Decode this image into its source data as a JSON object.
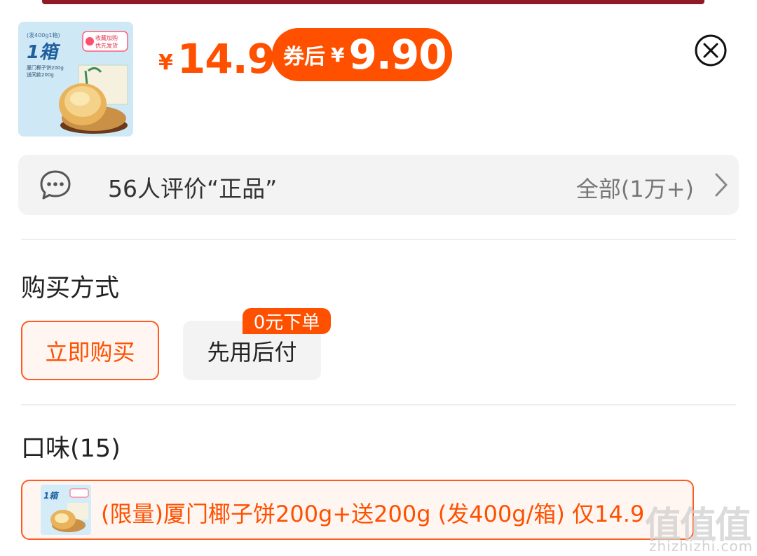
{
  "price": {
    "currency": "¥",
    "original": "14.9",
    "coupon_label": "券后",
    "coupon_currency": "¥",
    "coupon_price": "9.90"
  },
  "thumb": {
    "spec": "(发400g1箱)",
    "box_label": "1箱",
    "promo_line1": "收藏加购",
    "promo_line2": "优先发货",
    "desc_line1": "厦门椰子饼200g",
    "desc_line2": "送同款200g"
  },
  "reviews": {
    "summary": "56人评价“正品”",
    "all": "全部(1万+)"
  },
  "purchase": {
    "title": "购买方式",
    "buy_now": "立即购买",
    "pay_later": "先用后付",
    "pay_later_badge": "0元下单"
  },
  "flavor": {
    "title": "口味(15)",
    "selected": "(限量)厦门椰子饼200g+送200g (发400g/箱) 仅14.9"
  },
  "watermark": {
    "glyphs": "值值值",
    "url": "zhizhizhi.com"
  },
  "colors": {
    "accent": "#ff5000",
    "accent_bg": "#fff6f2",
    "panel_bg": "#f3f3f3"
  }
}
